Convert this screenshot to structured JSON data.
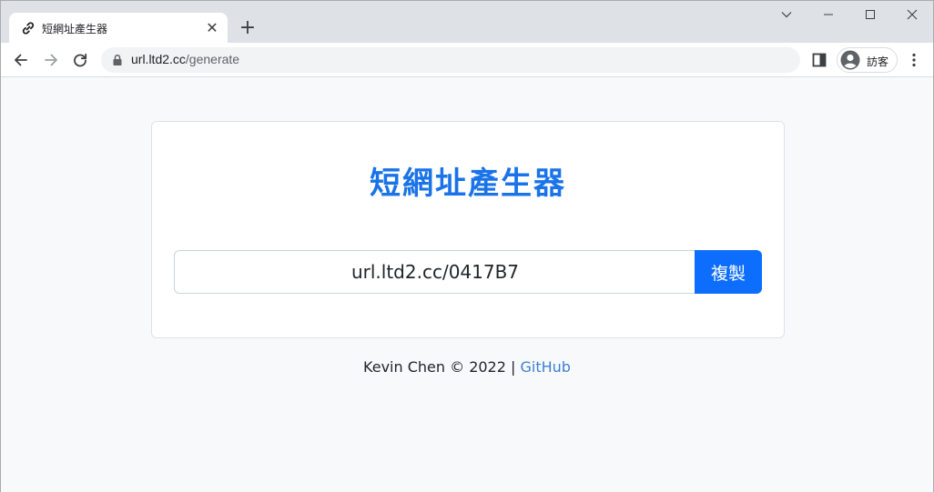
{
  "browser": {
    "tab": {
      "title": "短網址產生器",
      "icon": "link-icon",
      "close_glyph": "✕"
    },
    "new_tab_glyph": "+",
    "url_host": "url.ltd2.cc",
    "url_path": "/generate",
    "profile_label": "訪客"
  },
  "page": {
    "heading": "短網址產生器",
    "short_url_value": "url.ltd2.cc/0417B7",
    "copy_button_label": "複製",
    "footer": {
      "text": "Kevin Chen © 2022 |",
      "link_label": "GitHub"
    }
  },
  "colors": {
    "accent": "#0d6efd",
    "heading": "#1a73e8",
    "link": "#3d7fd6"
  }
}
